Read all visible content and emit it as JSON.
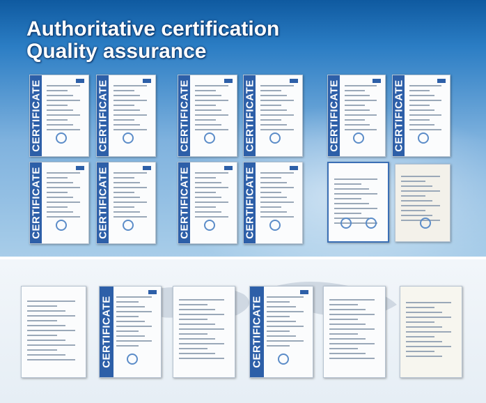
{
  "banner": {
    "line1": "Authoritative certification",
    "line2": "Quality assurance"
  },
  "certificate_label": "CERTIFICATE",
  "colors": {
    "banner_blue": "#2b7dc4",
    "cert_band": "#2d5fa8",
    "bottom_bg": "#eef3f8"
  }
}
